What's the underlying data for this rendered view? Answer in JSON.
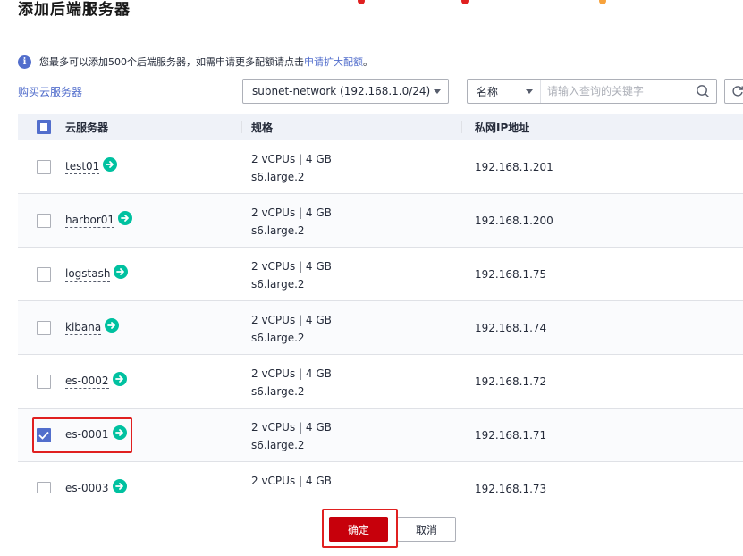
{
  "dialog": {
    "title": "添加后端服务器"
  },
  "notice": {
    "icon": "info-icon",
    "text": "您最多可以添加500个后端服务器，如需申请更多配额请点击",
    "link": "申请扩大配额",
    "tail": "。"
  },
  "toolbar": {
    "buy_link": "购买云服务器",
    "subnet_value": "subnet-network (192.168.1.0/24)",
    "search_field": "名称",
    "search_placeholder": "请输入查询的关键字"
  },
  "table": {
    "columns": [
      "云服务器",
      "规格",
      "私网IP地址"
    ],
    "rows": [
      {
        "name": "test01",
        "spec_line1": "2 vCPUs | 4 GB",
        "spec_line2": "s6.large.2",
        "ip": "192.168.1.201",
        "checked": false
      },
      {
        "name": "harbor01",
        "spec_line1": "2 vCPUs | 4 GB",
        "spec_line2": "s6.large.2",
        "ip": "192.168.1.200",
        "checked": false
      },
      {
        "name": "logstash",
        "spec_line1": "2 vCPUs | 4 GB",
        "spec_line2": "s6.large.2",
        "ip": "192.168.1.75",
        "checked": false
      },
      {
        "name": "kibana",
        "spec_line1": "2 vCPUs | 4 GB",
        "spec_line2": "s6.large.2",
        "ip": "192.168.1.74",
        "checked": false
      },
      {
        "name": "es-0002",
        "spec_line1": "2 vCPUs | 4 GB",
        "spec_line2": "s6.large.2",
        "ip": "192.168.1.72",
        "checked": false
      },
      {
        "name": "es-0001",
        "spec_line1": "2 vCPUs | 4 GB",
        "spec_line2": "s6.large.2",
        "ip": "192.168.1.71",
        "checked": true
      },
      {
        "name": "es-0003",
        "spec_line1": "2 vCPUs | 4 GB",
        "spec_line2": "",
        "ip": "192.168.1.73",
        "checked": false
      }
    ]
  },
  "footer": {
    "confirm_label": "确定",
    "cancel_label": "取消"
  },
  "colors": {
    "primary": "#526ecc",
    "confirm": "#c7000b",
    "go_icon": "#00c1a0",
    "highlight": "#e02020"
  }
}
